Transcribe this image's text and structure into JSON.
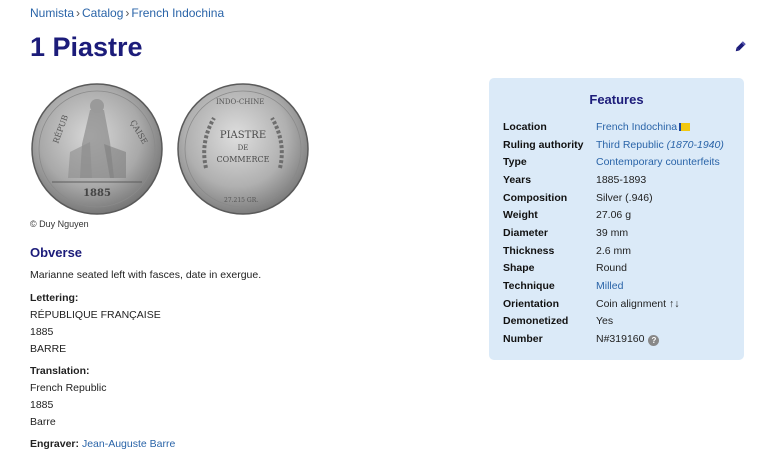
{
  "breadcrumb": {
    "items": [
      "Numista",
      "Catalog",
      "French Indochina"
    ],
    "separator": "›"
  },
  "title": "1 Piastre",
  "image_credit": "© Duy Nguyen",
  "coin_obverse": {
    "date": "1885",
    "legend": "RÉPUBLIQUE FRANÇAISE"
  },
  "coin_reverse": {
    "center_top": "PIASTRE",
    "center_mid": "DE",
    "center_bottom": "COMMERCE",
    "legend": "INDO-CHINE FRANÇAISE",
    "weight": "27.215 GRAMMES",
    "fineness": "TITRE 0,900"
  },
  "obverse": {
    "heading": "Obverse",
    "description": "Marianne seated left with fasces, date in exergue.",
    "lettering_label": "Lettering:",
    "lettering_lines": [
      "RÉPUBLIQUE FRANÇAISE",
      "1885",
      "BARRE"
    ],
    "translation_label": "Translation:",
    "translation_lines": [
      "French Republic",
      "1885",
      "Barre"
    ],
    "engraver_label": "Engraver:",
    "engraver_name": "Jean-Auguste Barre"
  },
  "features": {
    "heading": "Features",
    "location_label": "Location",
    "location_value": "French Indochina",
    "ruling_label": "Ruling authority",
    "ruling_value": "Third Republic",
    "ruling_years": "(1870-1940)",
    "type_label": "Type",
    "type_value": "Contemporary counterfeits",
    "years_label": "Years",
    "years_value": "1885-1893",
    "composition_label": "Composition",
    "composition_value": "Silver (.946)",
    "weight_label": "Weight",
    "weight_value": "27.06 g",
    "diameter_label": "Diameter",
    "diameter_value": "39 mm",
    "thickness_label": "Thickness",
    "thickness_value": "2.6 mm",
    "shape_label": "Shape",
    "shape_value": "Round",
    "technique_label": "Technique",
    "technique_value": "Milled",
    "orientation_label": "Orientation",
    "orientation_value": "Coin alignment ↑↓",
    "demonetized_label": "Demonetized",
    "demonetized_value": "Yes",
    "number_label": "Number",
    "number_value": "N#319160"
  },
  "colors": {
    "title": "#1c1c7a",
    "link": "#2a64a8",
    "features_bg": "#dbeaf8"
  }
}
